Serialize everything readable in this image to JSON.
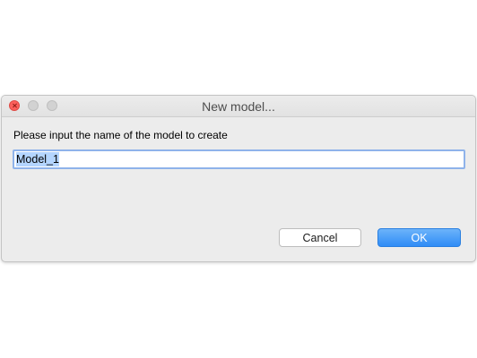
{
  "window": {
    "title": "New model...",
    "controls": {
      "close_icon": "close-icon",
      "minimize_icon": "minimize-icon",
      "maximize_icon": "maximize-icon"
    }
  },
  "form": {
    "prompt": "Please input the name of the model to create",
    "input_value": "Model_1"
  },
  "buttons": {
    "cancel_label": "Cancel",
    "ok_label": "OK"
  },
  "colors": {
    "close": "#fc605c",
    "inactive_light": "#d2d2d2",
    "accent": "#3a8ef6",
    "selection": "#b4d5fe",
    "focus_ring": "#8fb3ea"
  }
}
